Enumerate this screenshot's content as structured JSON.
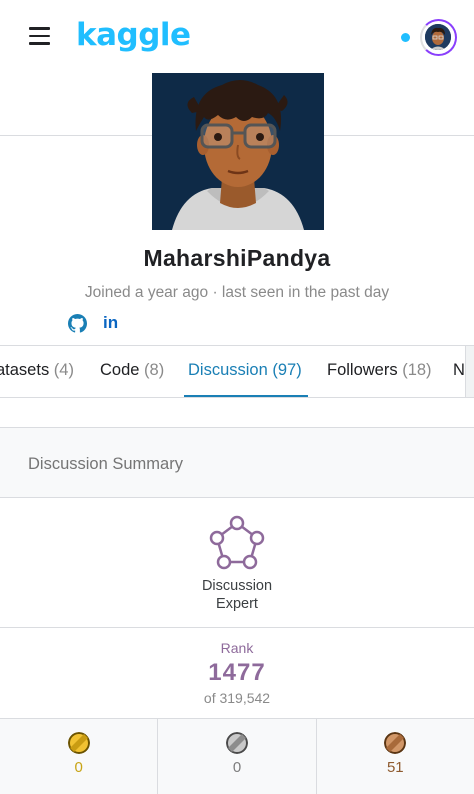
{
  "header": {
    "menu_icon": "hamburger-menu-icon",
    "logo": "kaggle",
    "accent_color": "#20beff"
  },
  "profile": {
    "username": "MaharshiPandya",
    "joined": "Joined a year ago · last seen in the past day",
    "social": [
      "github-icon",
      "linkedin-icon"
    ],
    "linkedin_glyph": "in"
  },
  "tabs": [
    {
      "label": "Datasets",
      "count": "(4)",
      "visible_label": "atasets"
    },
    {
      "label": "Code",
      "count": "(8)"
    },
    {
      "label": "Discussion",
      "count": "(97)",
      "active": true
    },
    {
      "label": "Followers",
      "count": "(18)"
    },
    {
      "label": "N",
      "count": ""
    }
  ],
  "summary": {
    "title": "Discussion Summary",
    "tier_line1": "Discussion",
    "tier_line2": "Expert",
    "tier_color": "#8e6a9b",
    "rank_label": "Rank",
    "rank_value": "1477",
    "rank_of": "of 319,542"
  },
  "medals": [
    {
      "type": "gold",
      "count": "0",
      "color": "#c8a415"
    },
    {
      "type": "silver",
      "count": "0",
      "color": "#7d7d7d"
    },
    {
      "type": "bronze",
      "count": "51",
      "color": "#8e5b2f"
    }
  ]
}
